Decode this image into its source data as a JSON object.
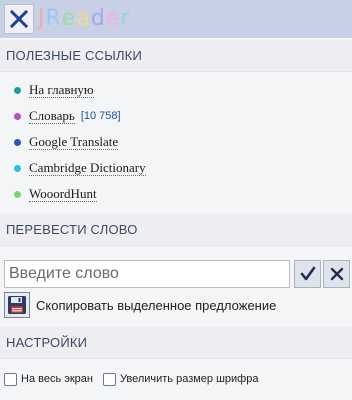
{
  "app": {
    "logo_letters": [
      {
        "ch": "J",
        "color": "#f2a8a8"
      },
      {
        "ch": "R",
        "color": "#9ec6f5"
      },
      {
        "ch": "e",
        "color": "#9fdca0"
      },
      {
        "ch": "a",
        "color": "#f7d87a"
      },
      {
        "ch": "d",
        "color": "#a7a7ef"
      },
      {
        "ch": "e",
        "color": "#f2b0d7"
      },
      {
        "ch": "r",
        "color": "#8fd7dc"
      }
    ],
    "close_icon": "close-x-icon"
  },
  "useful_links": {
    "heading": "ПОЛЕЗНЫЕ ССЫЛКИ",
    "items": [
      {
        "label": "На главную",
        "dot_color": "#1a9e9c",
        "count": ""
      },
      {
        "label": "Словарь",
        "dot_color": "#b44fc4",
        "count": "[10 758]"
      },
      {
        "label": "Google Translate",
        "dot_color": "#2a55c9",
        "count": ""
      },
      {
        "label": "Cambridge Dictionary",
        "dot_color": "#2bc0e0",
        "count": ""
      },
      {
        "label": "WooordHunt",
        "dot_color": "#7bd86a",
        "count": ""
      }
    ]
  },
  "translate": {
    "heading": "ПЕРЕВЕСТИ СЛОВО",
    "placeholder": "Введите слово",
    "confirm_icon": "checkmark-icon",
    "clear_icon": "close-x-icon",
    "copy_label": "Скопировать выделенное предложение",
    "copy_icon": "floppy-disk-icon"
  },
  "settings": {
    "heading": "НАСТРОЙКИ",
    "fullscreen_label": "На весь экран",
    "font_size_label": "Увеличить размер шрифра"
  },
  "colors": {
    "titlebar": "#c8d0e6",
    "section_bg": "#eceef2",
    "link_count": "#1d4fb0"
  }
}
